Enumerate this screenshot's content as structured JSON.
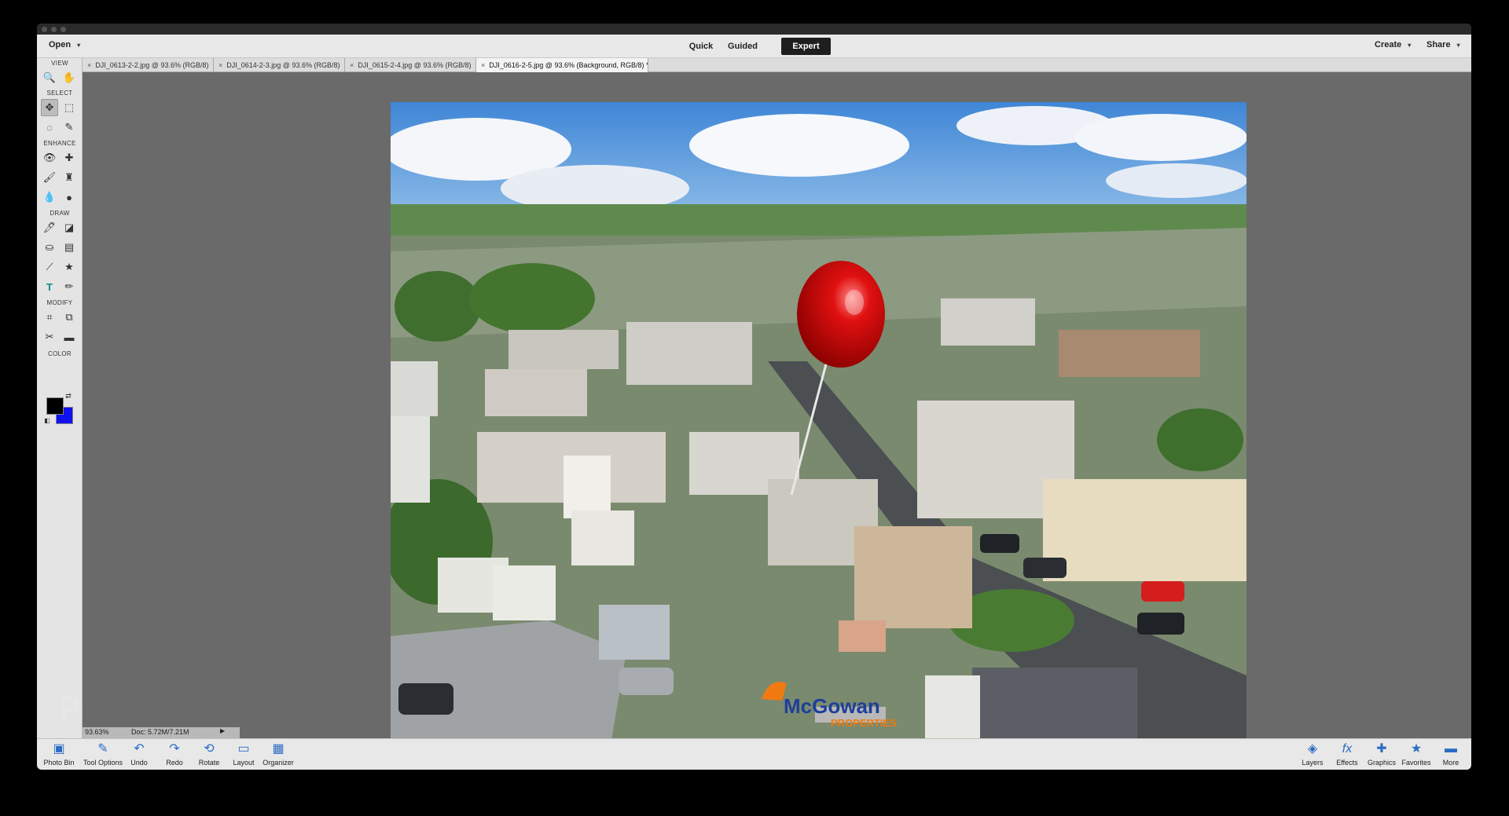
{
  "menubar": {
    "open_label": "Open",
    "modes": [
      "Quick",
      "Guided",
      "Expert"
    ],
    "active_mode": "Expert",
    "create_label": "Create",
    "share_label": "Share"
  },
  "tabs": [
    {
      "label": "DJI_0613-2-2.jpg @ 93.6% (RGB/8)"
    },
    {
      "label": "DJI_0614-2-3.jpg @ 93.6% (RGB/8)"
    },
    {
      "label": "DJI_0615-2-4.jpg @ 93.6% (RGB/8)"
    },
    {
      "label": "DJI_0616-2-5.jpg @ 93.6% (Background, RGB/8) *",
      "active": true
    }
  ],
  "toolbar": {
    "sections": {
      "view": "VIEW",
      "select": "SELECT",
      "enhance": "ENHANCE",
      "draw": "DRAW",
      "modify": "MODIFY",
      "color": "COLOR"
    }
  },
  "status": {
    "zoom": "93.63%",
    "doc": "Doc: 5.72M/7.21M"
  },
  "photo": {
    "logo_text": "McGowan",
    "logo_sub": "PROPERTIES"
  },
  "watermark": "Property",
  "bottom_left": [
    {
      "label": "Photo Bin",
      "icon": "photo-bin-icon"
    },
    {
      "label": "Tool Options",
      "icon": "tool-options-icon"
    },
    {
      "label": "Undo",
      "icon": "undo-icon"
    },
    {
      "label": "Redo",
      "icon": "redo-icon"
    },
    {
      "label": "Rotate",
      "icon": "rotate-icon"
    },
    {
      "label": "Layout",
      "icon": "layout-icon"
    },
    {
      "label": "Organizer",
      "icon": "organizer-icon"
    }
  ],
  "bottom_right": [
    {
      "label": "Layers",
      "icon": "layers-icon"
    },
    {
      "label": "Effects",
      "icon": "effects-icon"
    },
    {
      "label": "Graphics",
      "icon": "graphics-icon"
    },
    {
      "label": "Favorites",
      "icon": "favorites-icon"
    },
    {
      "label": "More",
      "icon": "more-icon"
    }
  ],
  "colors": {
    "foreground": "#000000",
    "background": "#1010f0",
    "accent": "#2b6cc4"
  }
}
